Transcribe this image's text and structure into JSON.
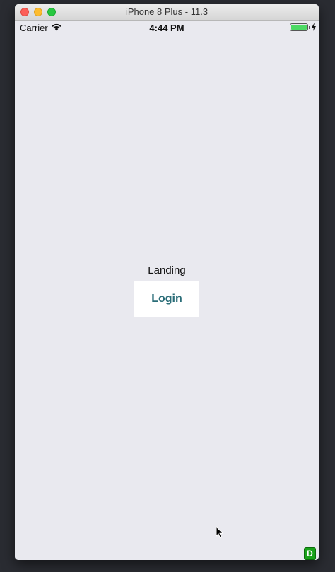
{
  "window": {
    "title": "iPhone 8 Plus - 11.3"
  },
  "status_bar": {
    "carrier": "Carrier",
    "time": "4:44 PM",
    "battery_level": 1.0
  },
  "screen": {
    "heading": "Landing",
    "login_label": "Login",
    "debug_badge": "D"
  },
  "colors": {
    "background": "#e9e9ef",
    "button_text": "#2a6d78",
    "battery": "#4cd964",
    "debug_badge": "#1aa31a"
  },
  "icons": {
    "wifi": "wifi-icon",
    "battery": "battery-icon",
    "charging": "bolt-icon",
    "cursor": "mouse-cursor-icon"
  }
}
